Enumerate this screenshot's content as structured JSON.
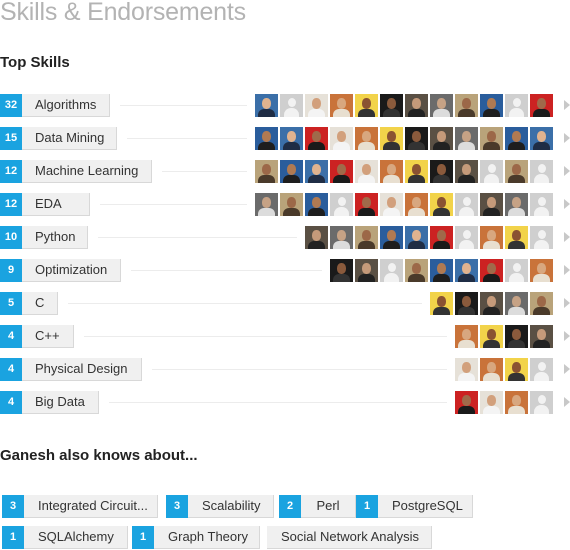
{
  "header": {
    "title": "Skills & Endorsements"
  },
  "top_skills": {
    "heading": "Top Skills",
    "items": [
      {
        "count": "32",
        "label": "Algorithms",
        "avatars": [
          "photo",
          "ghost",
          "photo",
          "photo",
          "photo",
          "photo",
          "photo",
          "photo",
          "photo",
          "photo",
          "ghost",
          "photo"
        ]
      },
      {
        "count": "15",
        "label": "Data Mining",
        "avatars": [
          "photo",
          "photo",
          "photo",
          "photo",
          "photo",
          "photo",
          "photo",
          "photo",
          "photo",
          "photo",
          "photo",
          "photo"
        ]
      },
      {
        "count": "12",
        "label": "Machine Learning",
        "avatars": [
          "photo",
          "photo",
          "photo",
          "photo",
          "photo",
          "photo",
          "photo",
          "photo",
          "photo",
          "ghost",
          "photo",
          "ghost"
        ]
      },
      {
        "count": "12",
        "label": "EDA",
        "avatars": [
          "photo",
          "photo",
          "photo",
          "ghost",
          "photo",
          "photo",
          "photo",
          "photo",
          "ghost",
          "photo",
          "photo",
          "ghost"
        ]
      },
      {
        "count": "10",
        "label": "Python",
        "avatars": [
          "photo",
          "photo",
          "photo",
          "photo",
          "photo",
          "photo",
          "ghost",
          "photo",
          "photo",
          "ghost"
        ]
      },
      {
        "count": "9",
        "label": "Optimization",
        "avatars": [
          "photo",
          "photo",
          "ghost",
          "photo",
          "photo",
          "photo",
          "photo",
          "ghost",
          "photo"
        ]
      },
      {
        "count": "5",
        "label": "C",
        "avatars": [
          "photo",
          "photo",
          "photo",
          "photo",
          "photo"
        ]
      },
      {
        "count": "4",
        "label": "C++",
        "avatars": [
          "photo",
          "photo",
          "photo",
          "photo"
        ]
      },
      {
        "count": "4",
        "label": "Physical Design",
        "avatars": [
          "photo",
          "photo",
          "photo",
          "ghost"
        ]
      },
      {
        "count": "4",
        "label": "Big Data",
        "avatars": [
          "photo",
          "photo",
          "photo",
          "ghost"
        ]
      }
    ],
    "more_icon": "chevron-right-icon"
  },
  "also_knows": {
    "heading": "Ganesh also knows about...",
    "items": [
      {
        "count": "3",
        "label": "Integrated Circuit..."
      },
      {
        "count": "3",
        "label": "Scalability"
      },
      {
        "count": "2",
        "label": "Perl"
      },
      {
        "count": "1",
        "label": "PostgreSQL"
      },
      {
        "count": "1",
        "label": "SQLAlchemy"
      },
      {
        "count": "1",
        "label": "Graph Theory"
      },
      {
        "count": "",
        "label": "Social Network Analysis"
      }
    ]
  },
  "colors": {
    "badge": "#1aa3e0",
    "pill": "#f0f0f0",
    "title": "#b3b3b3"
  }
}
